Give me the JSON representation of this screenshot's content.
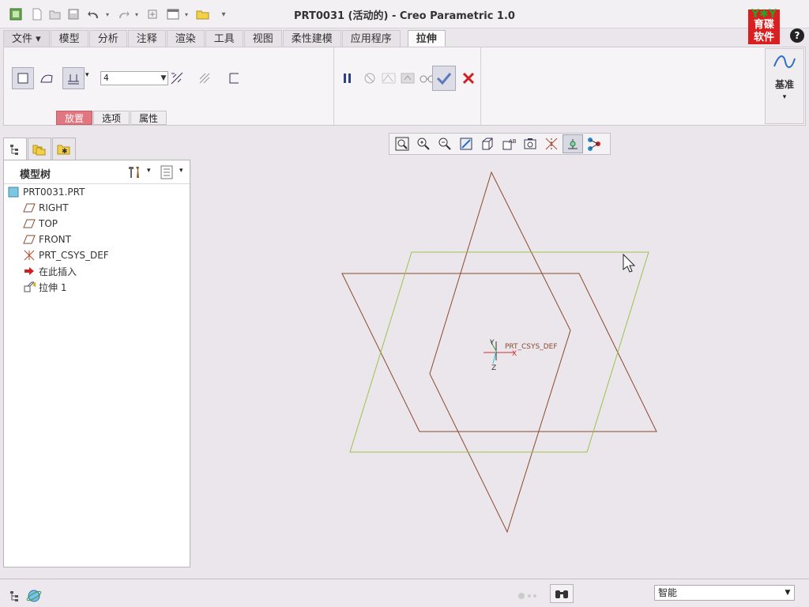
{
  "window": {
    "title": "PRT0031 (活动的) - Creo Parametric 1.0"
  },
  "logo": {
    "text_line1": "育碟",
    "text_line2": "软件"
  },
  "ribbon_tabs": [
    {
      "label": "文件 ▾"
    },
    {
      "label": "模型"
    },
    {
      "label": "分析"
    },
    {
      "label": "注释"
    },
    {
      "label": "渲染"
    },
    {
      "label": "工具"
    },
    {
      "label": "视图"
    },
    {
      "label": "柔性建模"
    },
    {
      "label": "应用程序"
    },
    {
      "label": "拉伸"
    }
  ],
  "extrude": {
    "depth_value": "4",
    "subtabs": [
      {
        "label": "放置"
      },
      {
        "label": "选项"
      },
      {
        "label": "属性"
      }
    ]
  },
  "datum": {
    "label": "基准"
  },
  "model_tree": {
    "title": "模型树",
    "items": [
      {
        "label": "PRT0031.PRT"
      },
      {
        "label": "RIGHT"
      },
      {
        "label": "TOP"
      },
      {
        "label": "FRONT"
      },
      {
        "label": "PRT_CSYS_DEF"
      },
      {
        "label": "在此插入"
      },
      {
        "label": "拉伸 1"
      }
    ]
  },
  "graphics": {
    "csys_label": "PRT_CSYS_DEF",
    "axis_x": "X",
    "axis_y": "Y",
    "axis_z": "Z",
    "colors": {
      "plane_brown": "#8a4a2e",
      "plane_green": "#9cc24a",
      "axis_red": "#d03030"
    }
  },
  "statusbar": {
    "filter_value": "智能"
  }
}
